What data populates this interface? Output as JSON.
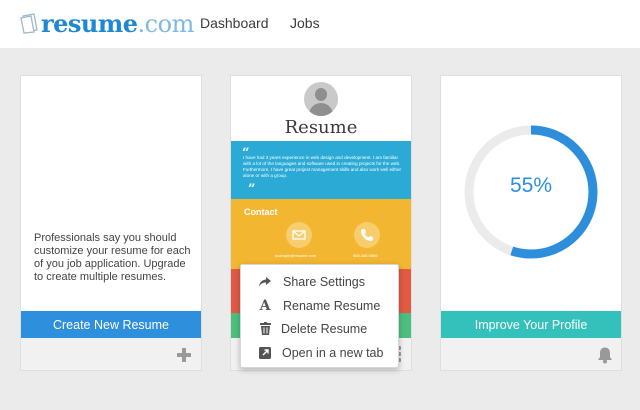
{
  "header": {
    "logo": {
      "bold": "resume",
      "light": ".com"
    },
    "nav": [
      "Dashboard",
      "Jobs"
    ]
  },
  "cards": {
    "new": {
      "description": "Professionals say you should customize your resume for each of you job application. Upgrade to create multiple resumes.",
      "button": "Create New Resume",
      "footer_icon": "plus-icon"
    },
    "resume": {
      "title": "Resume",
      "bio": "I have had 3 years experience in web design and development. I am familiar with a lot of the languages and software used in creating projects for the web. Furthermore, I have great project management skills and also work well either alone or with a group.",
      "contact_heading": "Contact",
      "email": "example@resume.com",
      "phone": "555.468.5866",
      "colors": {
        "blue": "#2aaad5",
        "yellow": "#f2b631",
        "red": "#e05a44",
        "green": "#4cbf80"
      }
    },
    "profile": {
      "percent_label": "55%",
      "progress": 0.55,
      "button": "Improve Your Profile",
      "footer_icon": "bell-icon"
    }
  },
  "context_menu": {
    "items": [
      {
        "label": "Share Settings",
        "icon": "share-icon"
      },
      {
        "label": "Rename Resume",
        "icon": "rename-icon"
      },
      {
        "label": "Delete Resume",
        "icon": "trash-icon"
      },
      {
        "label": "Open in a new tab",
        "icon": "external-link-icon"
      }
    ]
  },
  "colors": {
    "accent_blue": "#2e8fdc",
    "teal": "#35c1bb"
  }
}
